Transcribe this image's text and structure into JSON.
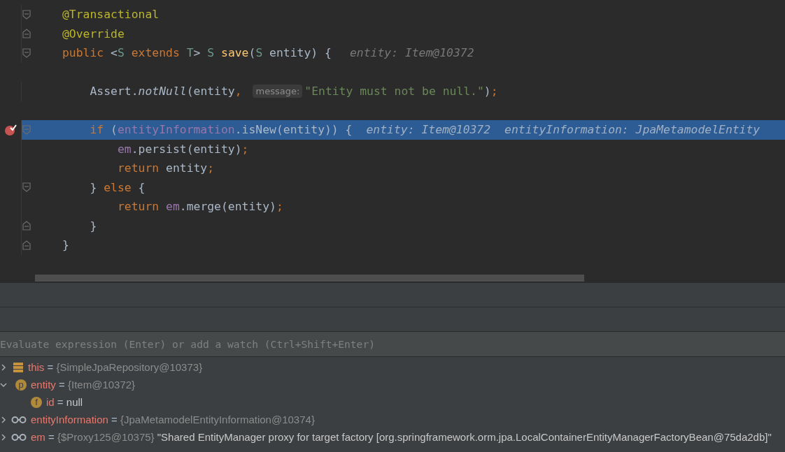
{
  "editor": {
    "lines": [
      {
        "fold_start": true,
        "tokens": [
          {
            "kind": "ann",
            "t": "@Transactional"
          }
        ]
      },
      {
        "fold_end": true,
        "tokens": [
          {
            "kind": "ann",
            "t": "@Override"
          }
        ]
      },
      {
        "fold_start": true,
        "tokens": [
          {
            "kind": "kw",
            "t": "public "
          },
          {
            "kind": "plain",
            "t": "<"
          },
          {
            "kind": "type",
            "t": "S"
          },
          {
            "kind": "kw",
            "t": " extends "
          },
          {
            "kind": "type",
            "t": "T"
          },
          {
            "kind": "plain",
            "t": "> "
          },
          {
            "kind": "type",
            "t": "S "
          },
          {
            "kind": "fn",
            "t": "save"
          },
          {
            "kind": "plain",
            "t": "("
          },
          {
            "kind": "type",
            "t": "S"
          },
          {
            "kind": "plain",
            "t": " entity) {"
          },
          {
            "kind": "value_hint",
            "t": "entity: Item@10372"
          }
        ]
      },
      {
        "gap_before": true,
        "tokens": [
          {
            "kind": "plain",
            "t": "    Assert."
          },
          {
            "kind": "static",
            "t": "notNull"
          },
          {
            "kind": "plain",
            "t": "(entity"
          },
          {
            "kind": "kw",
            "t": ", "
          },
          {
            "kind": "param_hint",
            "t": "message:"
          },
          {
            "kind": "str",
            "t": "\"Entity must not be null.\""
          },
          {
            "kind": "plain",
            "t": ")"
          },
          {
            "kind": "kw",
            "t": ";"
          }
        ]
      },
      {
        "gap_before": true,
        "fold_start": true,
        "current": true,
        "breakpoint": true,
        "tokens": [
          {
            "kind": "kw",
            "t": "    if "
          },
          {
            "kind": "plain",
            "t": "("
          },
          {
            "kind": "field",
            "t": "entityInformation"
          },
          {
            "kind": "plain",
            "t": ".isNew(entity)) {"
          },
          {
            "kind": "value_hint",
            "t": "entity: Item@10372"
          },
          {
            "kind": "value_hint",
            "t": "entityInformation: JpaMetamodelEntity"
          }
        ]
      },
      {
        "tokens": [
          {
            "kind": "field",
            "t": "        em"
          },
          {
            "kind": "plain",
            "t": ".persist(entity)"
          },
          {
            "kind": "kw",
            "t": ";"
          }
        ]
      },
      {
        "tokens": [
          {
            "kind": "kw",
            "t": "        return "
          },
          {
            "kind": "plain",
            "t": "entity"
          },
          {
            "kind": "kw",
            "t": ";"
          }
        ]
      },
      {
        "fold_start": true,
        "tokens": [
          {
            "kind": "plain",
            "t": "    } "
          },
          {
            "kind": "kw",
            "t": "else "
          },
          {
            "kind": "plain",
            "t": "{"
          }
        ]
      },
      {
        "tokens": [
          {
            "kind": "kw",
            "t": "        return "
          },
          {
            "kind": "field",
            "t": "em"
          },
          {
            "kind": "plain",
            "t": ".merge(entity)"
          },
          {
            "kind": "kw",
            "t": ";"
          }
        ]
      },
      {
        "fold_end": true,
        "tokens": [
          {
            "kind": "plain",
            "t": "    }"
          }
        ]
      },
      {
        "fold_end": true,
        "tokens": [
          {
            "kind": "plain",
            "t": "}"
          }
        ]
      }
    ]
  },
  "evaluate": {
    "placeholder": "Evaluate expression (Enter) or add a watch (Ctrl+Shift+Enter)"
  },
  "variables": [
    {
      "kind": "stack",
      "name": "this",
      "sep": "=",
      "value": "{SimpleJpaRepository@10373}",
      "literal": false,
      "expanded": false
    },
    {
      "kind": "badge",
      "badge": "p",
      "name": "entity",
      "sep": "=",
      "value": "{Item@10372}",
      "literal": false,
      "expanded": true,
      "children": [
        {
          "kind": "badge",
          "badge": "f",
          "name": "id",
          "sep": "=",
          "value": "null",
          "literal": true
        }
      ]
    },
    {
      "kind": "watch",
      "name": "entityInformation",
      "sep": "=",
      "value": "{JpaMetamodelEntityInformation@10374}",
      "literal": false,
      "expanded": false
    },
    {
      "kind": "watch",
      "name": "em",
      "sep": "=",
      "value": "{$Proxy125@10375}",
      "literal": false,
      "extra": "\"Shared EntityManager proxy for target factory [org.springframework.orm.jpa.LocalContainerEntityManagerFactoryBean@75da2db]\"",
      "expanded": false
    }
  ]
}
